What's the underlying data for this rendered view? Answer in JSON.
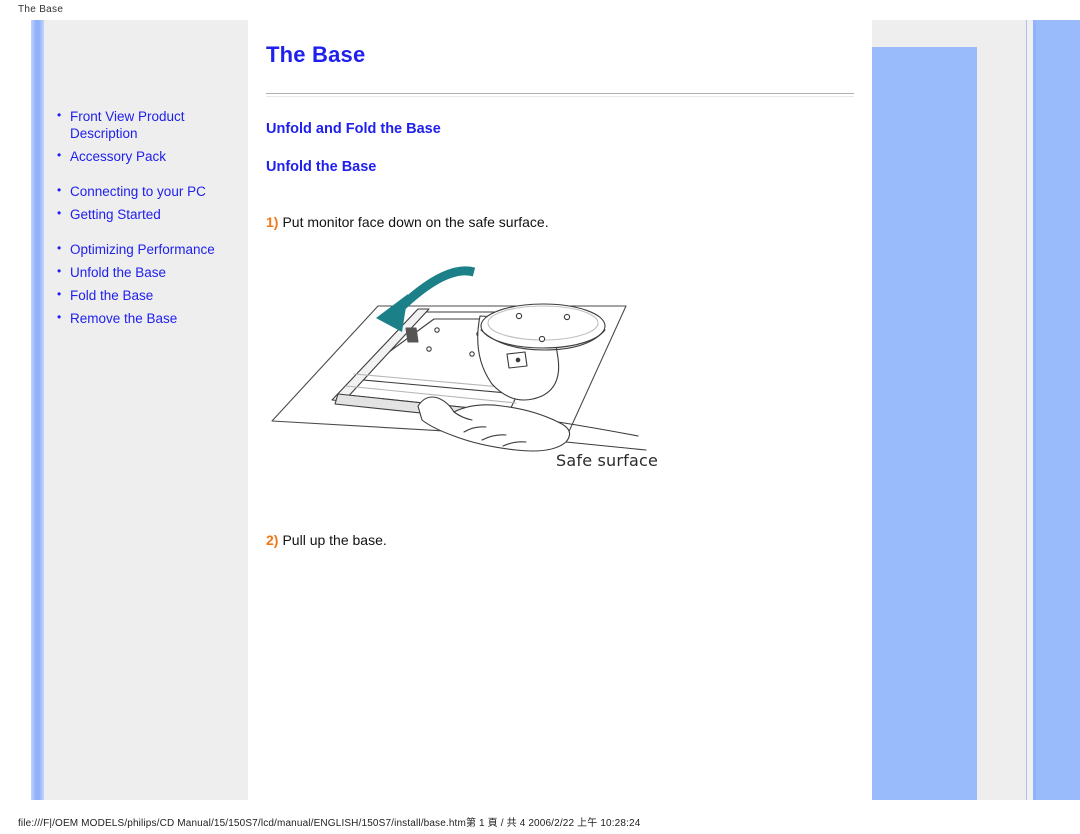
{
  "print_header": "The Base",
  "print_footer": "file:///F|/OEM MODELS/philips/CD Manual/15/150S7/lcd/manual/ENGLISH/150S7/install/base.htm第 1 頁 / 共 4 2006/2/22 上午 10:28:24",
  "colors": {
    "link_blue": "#2020ee",
    "heading_blue": "#2020ee",
    "step_orange": "#f07818",
    "sidebar_gray": "#eeeeee",
    "accent_blue": "#99bbfb",
    "arrow_teal": "#1b8087"
  },
  "sidebar": {
    "groups": [
      {
        "items": [
          {
            "label": "Front View Product Description"
          },
          {
            "label": "Accessory Pack"
          }
        ]
      },
      {
        "items": [
          {
            "label": "Connecting to your PC"
          },
          {
            "label": "Getting Started"
          }
        ]
      },
      {
        "items": [
          {
            "label": "Optimizing Performance"
          },
          {
            "label": "Unfold the Base"
          },
          {
            "label": "Fold the Base"
          },
          {
            "label": "Remove the Base"
          }
        ]
      }
    ]
  },
  "main": {
    "title": "The Base",
    "section_title": "Unfold and Fold the Base",
    "sub_title": "Unfold the Base",
    "steps": [
      {
        "number": "1)",
        "text": "Put monitor face down on the safe surface."
      },
      {
        "number": "2)",
        "text": "Pull up the base."
      }
    ],
    "figure": {
      "caption": "Safe surface",
      "alt": "monitor-laid-face-down-illustration"
    }
  }
}
